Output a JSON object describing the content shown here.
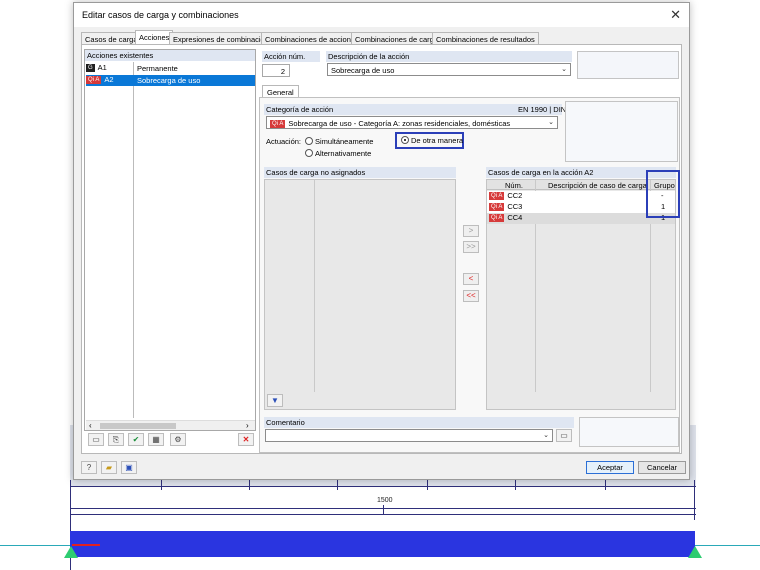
{
  "dialog": {
    "title": "Editar casos de carga y combinaciones",
    "tabs": [
      "Casos de carga",
      "Acciones",
      "Expresiones de combinación",
      "Combinaciones de acciones",
      "Combinaciones de carga",
      "Combinaciones de resultados"
    ],
    "active_tab": "Acciones"
  },
  "actions_list": {
    "header": "Acciones existentes",
    "items": [
      {
        "tag": "G",
        "id": "A1",
        "name": "Permanente",
        "tag_color": "#202020"
      },
      {
        "tag": "Qi A",
        "id": "A2",
        "name": "Sobrecarga de uso",
        "tag_color": "#d63a3a",
        "selected": true
      }
    ]
  },
  "action_header": {
    "num_label": "Acción núm.",
    "num_value": "2",
    "desc_label": "Descripción de la acción",
    "desc_value": "Sobrecarga de uso"
  },
  "general": {
    "tab_label": "General",
    "category_label": "Categoría de acción",
    "norm": "EN 1990 | DIN",
    "category_tag": "Qi A",
    "category_value": "Sobrecarga de uso - Categoría A: zonas residenciales, domésticas",
    "actuacion_label": "Actuación:",
    "options": [
      "Simultáneamente",
      "Alternativamente",
      "De otra manera"
    ],
    "selected_option": "De otra manera"
  },
  "unassigned": {
    "header": "Casos de carga no asignados"
  },
  "assigned": {
    "header": "Casos de carga en la acción A2",
    "columns": [
      "Núm.",
      "Descripción de caso de carga",
      "Grupo"
    ],
    "rows": [
      {
        "tag": "Qi A",
        "num": "CC2",
        "desc": "",
        "group": "-"
      },
      {
        "tag": "Qi A",
        "num": "CC3",
        "desc": "",
        "group": "1"
      },
      {
        "tag": "Qi A",
        "num": "CC4",
        "desc": "",
        "group": "1"
      }
    ]
  },
  "transfer_buttons": [
    ">",
    ">>",
    "<",
    "<<"
  ],
  "comment": {
    "label": "Comentario",
    "value": ""
  },
  "footer": {
    "ok": "Aceptar",
    "cancel": "Cancelar"
  },
  "background": {
    "dimension": "1500"
  },
  "icons": [
    "close-icon",
    "help-icon",
    "open-icon",
    "save-icon",
    "filter-icon",
    "delete-icon"
  ]
}
